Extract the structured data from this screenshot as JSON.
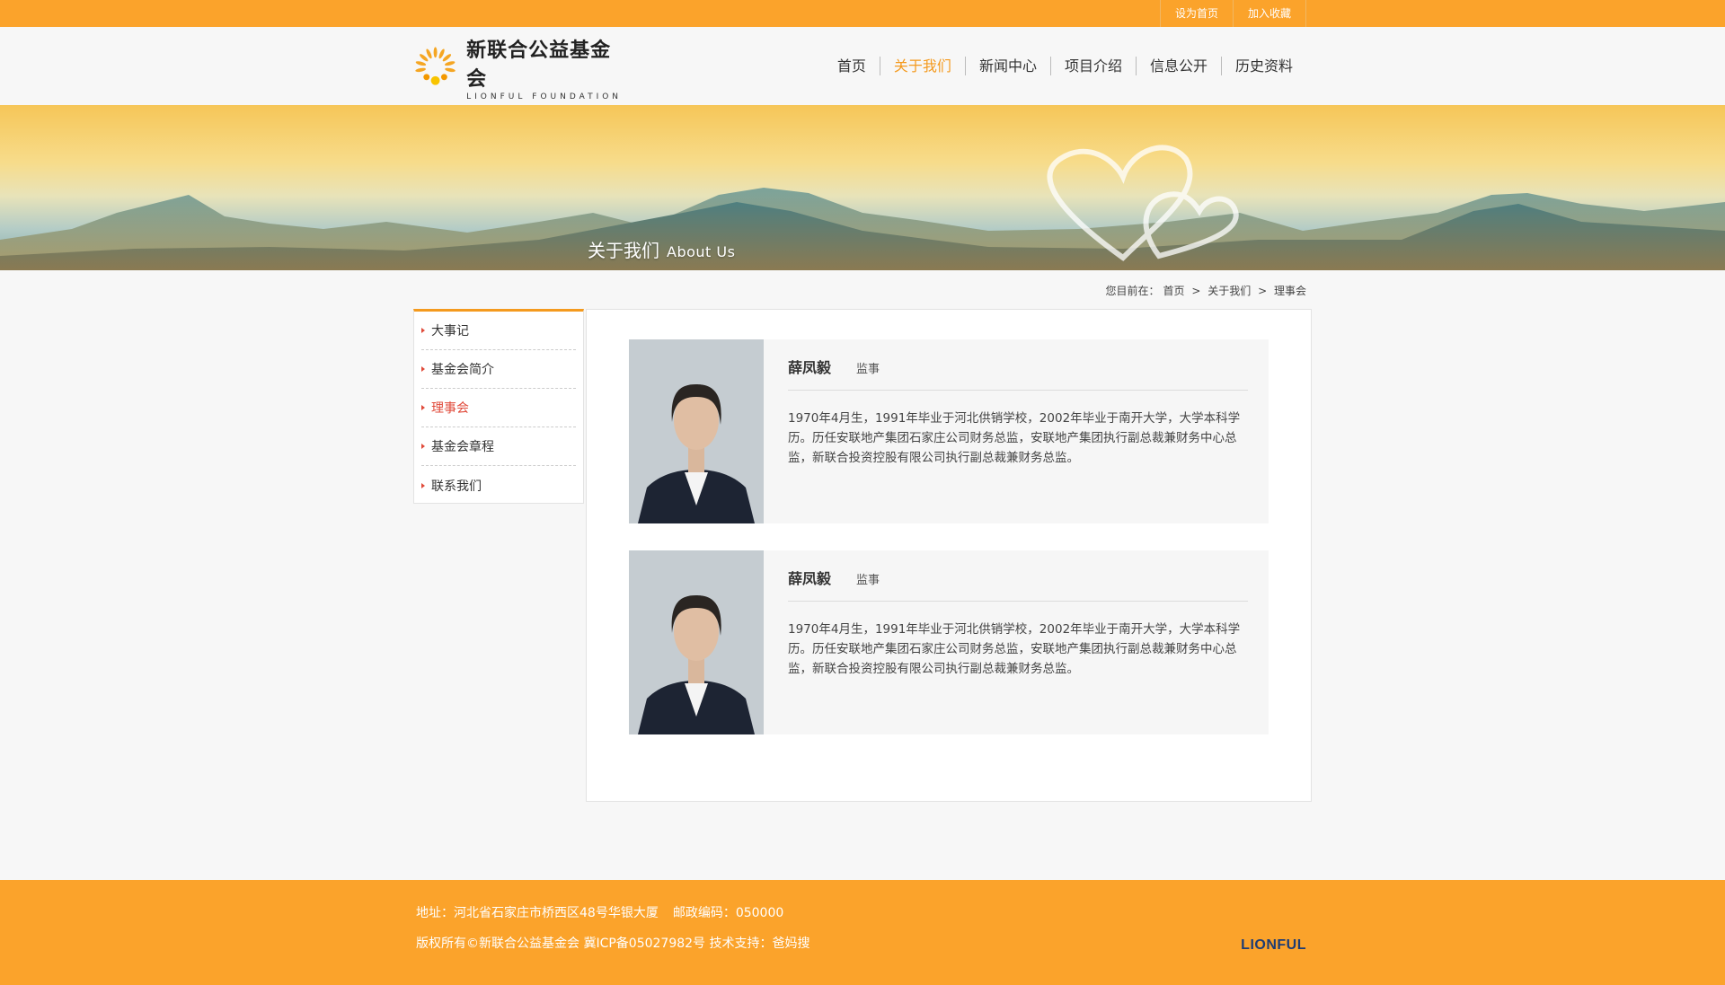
{
  "topbar": {
    "links": [
      "设为首页",
      "加入收藏"
    ]
  },
  "logo": {
    "cn": "新联合公益基金会",
    "en": "LIONFUL FOUNDATION"
  },
  "nav": {
    "items": [
      "首页",
      "关于我们",
      "新闻中心",
      "项目介绍",
      "信息公开",
      "历史资料"
    ],
    "active_index": 1
  },
  "banner": {
    "title_cn": "关于我们",
    "title_en": "About Us"
  },
  "breadcrumb": {
    "prefix": "您目前在：",
    "items": [
      "首页",
      "关于我们",
      "理事会"
    ],
    "separator": ">"
  },
  "sidebar": {
    "items": [
      "大事记",
      "基金会简介",
      "理事会",
      "基金会章程",
      "联系我们"
    ],
    "active_index": 2
  },
  "members": [
    {
      "name": "薛凤毅",
      "role": "监事",
      "bio": "1970年4月生，1991年毕业于河北供销学校，2002年毕业于南开大学，大学本科学历。历任安联地产集团石家庄公司财务总监，安联地产集团执行副总裁兼财务中心总监，新联合投资控股有限公司执行副总裁兼财务总监。"
    },
    {
      "name": "薛凤毅",
      "role": "监事",
      "bio": "1970年4月生，1991年毕业于河北供销学校，2002年毕业于南开大学，大学本科学历。历任安联地产集团石家庄公司财务总监，安联地产集团执行副总裁兼财务中心总监，新联合投资控股有限公司执行副总裁兼财务总监。"
    }
  ],
  "footer": {
    "address": "地址：河北省石家庄市桥西区48号华银大厦",
    "zip": "邮政编码：050000",
    "copyright": "版权所有©新联合公益基金会 冀ICP备05027982号 技术支持：爸妈搜",
    "brand": "LIONFUL"
  },
  "colors": {
    "accent": "#fba32b",
    "active_nav": "#f49a1e",
    "active_sidebar": "#e04a3a",
    "brand_text": "#1d3c74"
  }
}
